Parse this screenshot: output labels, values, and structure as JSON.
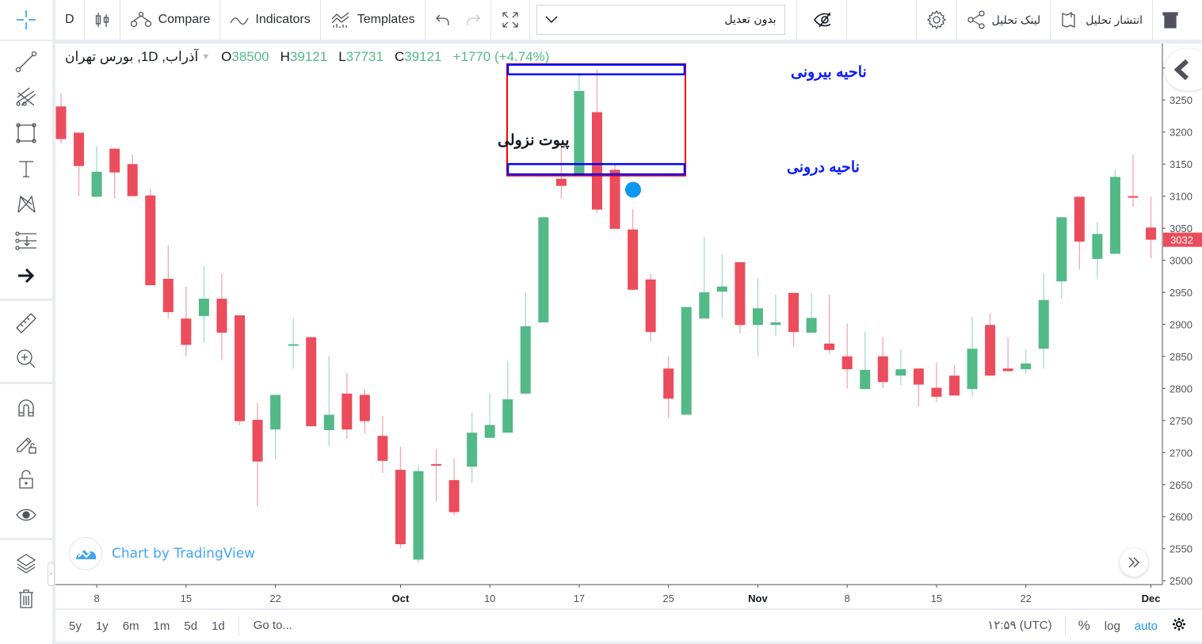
{
  "toolbar": {
    "interval": "D",
    "compare": "Compare",
    "indicators": "Indicators",
    "templates": "Templates",
    "adjustment_select": "بدون تعدیل",
    "settings_icon": "gear-icon",
    "share_link": "لینک تحلیل",
    "publish": "انتشار تحلیل"
  },
  "legend": {
    "symbol": "آذراب, 1D, بورس تهران",
    "open_label": "O",
    "open": "38500",
    "high_label": "H",
    "high": "39121",
    "low_label": "L",
    "low": "37731",
    "close_label": "C",
    "close": "39121",
    "change": "+1770 (+4.74%)"
  },
  "watermark": "Chart by TradingView",
  "bottom": {
    "ranges": [
      "5y",
      "1y",
      "6m",
      "1m",
      "5d",
      "1d"
    ],
    "goto": "Go to...",
    "time": "۱۲:۵۹ (UTC)",
    "percent": "%",
    "log": "log",
    "auto": "auto"
  },
  "colors": {
    "up": "#53b987",
    "down": "#eb4d5c",
    "accent": "#2196f3",
    "zone_box": "#ff0000",
    "zone_lines": "#0000ff"
  },
  "chart_data": {
    "type": "candlestick",
    "ylim": [
      2494,
      3338
    ],
    "y_ticks": [
      2500,
      2550,
      2600,
      2650,
      2700,
      2750,
      2800,
      2850,
      2900,
      2950,
      3000,
      3050,
      3100,
      3150,
      3200,
      3250,
      3300
    ],
    "last_price": "3032",
    "x_tick_labels": [
      "8",
      "15",
      "22",
      "Oct",
      "10",
      "17",
      "25",
      "Nov",
      "8",
      "15",
      "22",
      "Dec"
    ],
    "candles_ohlc": [
      [
        3240,
        3260,
        3182,
        3189
      ],
      [
        3199,
        3199,
        3100,
        3147
      ],
      [
        3099,
        3178,
        3099,
        3138
      ],
      [
        3174,
        3174,
        3096,
        3137
      ],
      [
        3150,
        3165,
        3100,
        3100
      ],
      [
        3101,
        3111,
        2961,
        2961
      ],
      [
        2971,
        3023,
        2909,
        2919
      ],
      [
        2909,
        2959,
        2850,
        2868
      ],
      [
        2913,
        2991,
        2871,
        2940
      ],
      [
        2940,
        2980,
        2845,
        2887
      ],
      [
        2914,
        2914,
        2743,
        2749
      ],
      [
        2751,
        2778,
        2616,
        2686
      ],
      [
        2736,
        2790,
        2689,
        2790
      ],
      [
        2868,
        2910,
        2831,
        2869
      ],
      [
        2880,
        2880,
        2741,
        2741
      ],
      [
        2735,
        2850,
        2710,
        2759
      ],
      [
        2792,
        2823,
        2721,
        2736
      ],
      [
        2790,
        2799,
        2730,
        2749
      ],
      [
        2726,
        2757,
        2668,
        2687
      ],
      [
        2673,
        2709,
        2551,
        2557
      ],
      [
        2533,
        2679,
        2528,
        2671
      ],
      [
        2682,
        2706,
        2624,
        2680
      ],
      [
        2657,
        2691,
        2602,
        2607
      ],
      [
        2678,
        2762,
        2652,
        2731
      ],
      [
        2723,
        2792,
        2723,
        2743
      ],
      [
        2731,
        2842,
        2731,
        2783
      ],
      [
        2792,
        2949,
        2792,
        2897
      ],
      [
        2903,
        3067,
        2903,
        3067
      ],
      [
        3127,
        3179,
        3096,
        3116
      ],
      [
        3132,
        3290,
        3132,
        3264
      ],
      [
        3231,
        3298,
        3073,
        3079
      ],
      [
        3141,
        3151,
        3049,
        3049
      ],
      [
        3048,
        3080,
        2953,
        2954
      ],
      [
        2970,
        2979,
        2873,
        2888
      ],
      [
        2831,
        2850,
        2754,
        2784
      ],
      [
        2759,
        2927,
        2759,
        2927
      ],
      [
        2909,
        3037,
        2909,
        2950
      ],
      [
        2951,
        3010,
        2911,
        2959
      ],
      [
        2997,
        2997,
        2886,
        2899
      ],
      [
        2899,
        2972,
        2851,
        2925
      ],
      [
        2899,
        2946,
        2882,
        2903
      ],
      [
        2949,
        2949,
        2865,
        2888
      ],
      [
        2887,
        2949,
        2887,
        2910
      ],
      [
        2870,
        2946,
        2854,
        2860
      ],
      [
        2850,
        2901,
        2800,
        2830
      ],
      [
        2799,
        2888,
        2799,
        2829
      ],
      [
        2850,
        2880,
        2800,
        2810
      ],
      [
        2820,
        2861,
        2805,
        2830
      ],
      [
        2831,
        2831,
        2772,
        2806
      ],
      [
        2801,
        2841,
        2779,
        2787
      ],
      [
        2820,
        2836,
        2789,
        2789
      ],
      [
        2799,
        2912,
        2788,
        2862
      ],
      [
        2899,
        2917,
        2820,
        2820
      ],
      [
        2831,
        2880,
        2827,
        2827
      ],
      [
        2830,
        2861,
        2823,
        2839
      ],
      [
        2862,
        2980,
        2831,
        2938
      ],
      [
        2967,
        3067,
        2940,
        3067
      ],
      [
        3099,
        3099,
        2986,
        3029
      ],
      [
        3002,
        3060,
        2971,
        3041
      ],
      [
        3010,
        3141,
        3010,
        3130
      ],
      [
        3100,
        3165,
        3083,
        3098
      ],
      [
        3051,
        3099,
        3003,
        3032
      ]
    ],
    "annotations": {
      "pivot_label": "پیوت نزولی",
      "outer_zone_label": "ناحیه بیرونی",
      "inner_zone_label": "ناحیه درونی",
      "pivot_box_price_range": [
        3132,
        3306
      ],
      "outer_zone_price_range": [
        3290,
        3305
      ],
      "inner_zone_price_range": [
        3134,
        3150
      ],
      "marker_price": 3110
    }
  }
}
